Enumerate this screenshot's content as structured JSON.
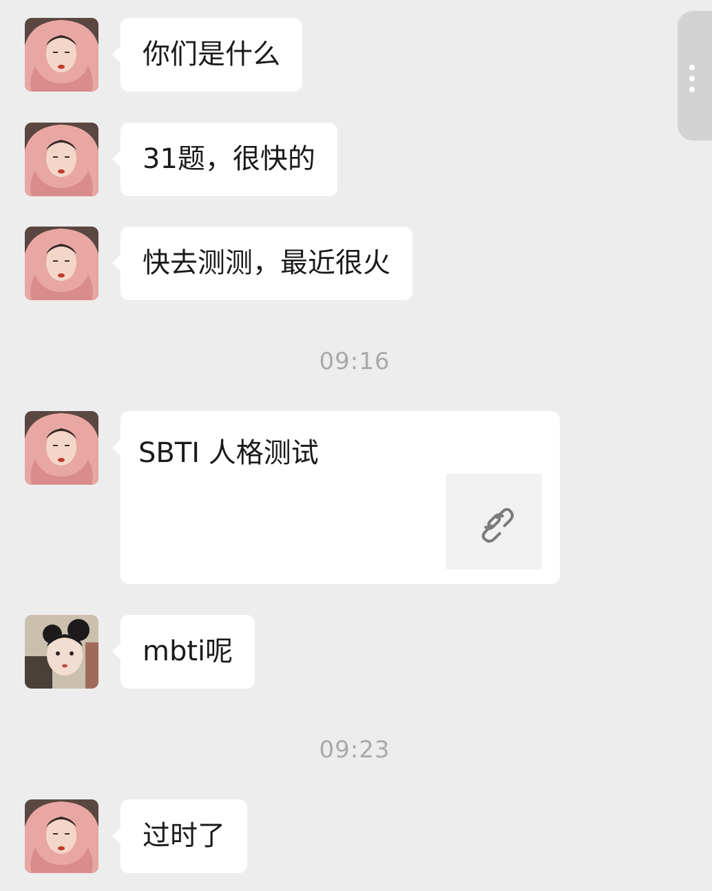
{
  "messages": [
    {
      "text": "你们是什么",
      "avatar": "pink-blanket-avatar"
    },
    {
      "text": "31题，很快的",
      "avatar": "pink-blanket-avatar"
    },
    {
      "text": "快去测测，最近很火",
      "avatar": "pink-blanket-avatar"
    },
    {
      "timestamp": "09:16"
    },
    {
      "link_title": "SBTI 人格测试",
      "avatar": "pink-blanket-avatar",
      "link_icon": "link-icon"
    },
    {
      "text": "mbti呢",
      "avatar": "girl-buns-avatar"
    },
    {
      "timestamp": "09:23"
    },
    {
      "text": "过时了",
      "avatar": "pink-blanket-avatar"
    }
  ],
  "side_handle": {
    "icon": "more-vertical-icon"
  },
  "colors": {
    "background": "#ededed",
    "bubble": "#ffffff",
    "timestamp": "#a9a9a9",
    "text": "#1a1a1a"
  }
}
